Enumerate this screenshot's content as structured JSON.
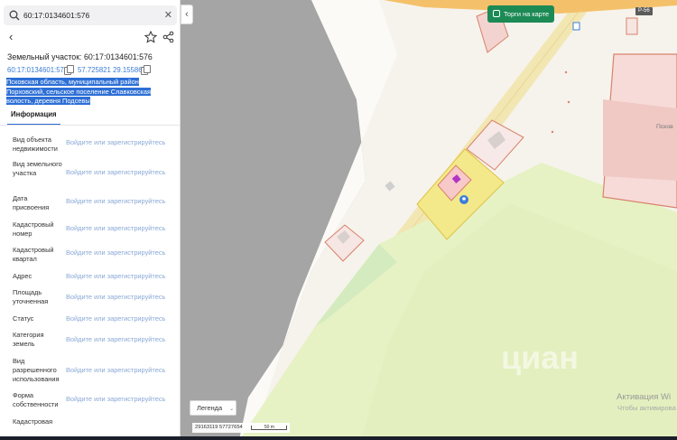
{
  "search": {
    "value": "60:17:0134601:576"
  },
  "parcel": {
    "title": "Земельный участок: 60:17:0134601:576",
    "cadastral_link": "60:17:0134601:576",
    "coordinates": "57.725821 29.155865",
    "address": "Псковская область, муниципальный район Порховский, сельское поселение Славковская волость, деревня Подсевы"
  },
  "tabs": [
    {
      "label": "Информация",
      "active": true
    }
  ],
  "info_rows": [
    {
      "label": "Вид объекта недвижимости",
      "value": "Войдите или зарегистрируйтесь"
    },
    {
      "label": "Вид земельного участка",
      "value": "Войдите или зарегистрируйтесь"
    },
    {
      "label": "Дата присвоения",
      "value": "Войдите или зарегистрируйтесь"
    },
    {
      "label": "Кадастровый номер",
      "value": "Войдите или зарегистрируйтесь"
    },
    {
      "label": "Кадастровый квартал",
      "value": "Войдите или зарегистрируйтесь"
    },
    {
      "label": "Адрес",
      "value": "Войдите или зарегистрируйтесь"
    },
    {
      "label": "Площадь уточненная",
      "value": "Войдите или зарегистрируйтесь"
    },
    {
      "label": "Статус",
      "value": "Войдите или зарегистрируйтесь"
    },
    {
      "label": "Категория земель",
      "value": "Войдите или зарегистрируйтесь"
    },
    {
      "label": "Вид разрешенного использования",
      "value": "Войдите или зарегистрируйтесь"
    },
    {
      "label": "Форма собственности",
      "value": "Войдите или зарегистрируйтесь"
    },
    {
      "label": "Кадастровая",
      "value": ""
    }
  ],
  "map": {
    "torgi_label": "Торги на карте",
    "road_badge": "Р-56",
    "legend_label": "Легенда",
    "scale_coords": "29163119  57727654",
    "scale_label": "50 m",
    "place_label": "Псков",
    "watermark": "циан"
  },
  "windows_notice": {
    "line1": "Активация Wi",
    "line2": "Чтобы активирова"
  },
  "colors": {
    "accent": "#2f6bd6",
    "torgi_green": "#1c8a55",
    "parcel_fill": "#f3e98a",
    "parcel_border": "#e08a6f",
    "field_green": "#e6f2c4"
  }
}
